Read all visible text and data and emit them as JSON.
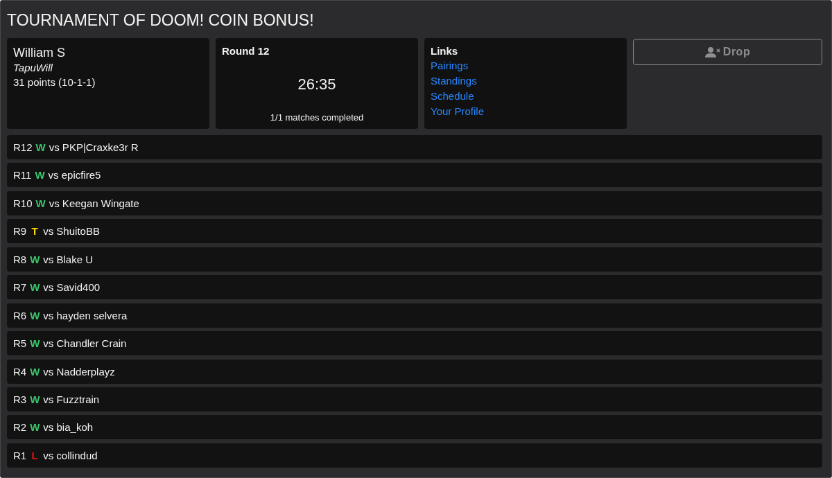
{
  "title": "TOURNAMENT OF DOOM! COIN BONUS!",
  "player": {
    "name": "William S",
    "username": "TapuWill",
    "record": "31 points (10-1-1)"
  },
  "round": {
    "label": "Round 12",
    "timer": "26:35",
    "status": "1/1 matches completed"
  },
  "links": {
    "heading": "Links",
    "items": [
      "Pairings",
      "Standings",
      "Schedule",
      "Your Profile"
    ]
  },
  "drop_button": {
    "label": "Drop",
    "disabled": true
  },
  "matches": [
    {
      "round": "R12",
      "result": "W",
      "color": "#3cc46d",
      "opponent": "vs PKP|Craxke3r R"
    },
    {
      "round": "R11",
      "result": "W",
      "color": "#3cc46d",
      "opponent": "vs epicfire5"
    },
    {
      "round": "R10",
      "result": "W",
      "color": "#3cc46d",
      "opponent": "vs Keegan Wingate"
    },
    {
      "round": "R9",
      "result": "T",
      "color": "#ffd200",
      "opponent": "vs ShuitoBB"
    },
    {
      "round": "R8",
      "result": "W",
      "color": "#3cc46d",
      "opponent": "vs Blake U"
    },
    {
      "round": "R7",
      "result": "W",
      "color": "#3cc46d",
      "opponent": "vs Savid400"
    },
    {
      "round": "R6",
      "result": "W",
      "color": "#3cc46d",
      "opponent": "vs hayden selvera"
    },
    {
      "round": "R5",
      "result": "W",
      "color": "#3cc46d",
      "opponent": "vs Chandler Crain"
    },
    {
      "round": "R4",
      "result": "W",
      "color": "#3cc46d",
      "opponent": "vs Nadderplayz"
    },
    {
      "round": "R3",
      "result": "W",
      "color": "#3cc46d",
      "opponent": "vs Fuzztrain"
    },
    {
      "round": "R2",
      "result": "W",
      "color": "#3cc46d",
      "opponent": "vs bia_koh"
    },
    {
      "round": "R1",
      "result": "L",
      "color": "#e0140e",
      "opponent": "vs collindud"
    }
  ]
}
